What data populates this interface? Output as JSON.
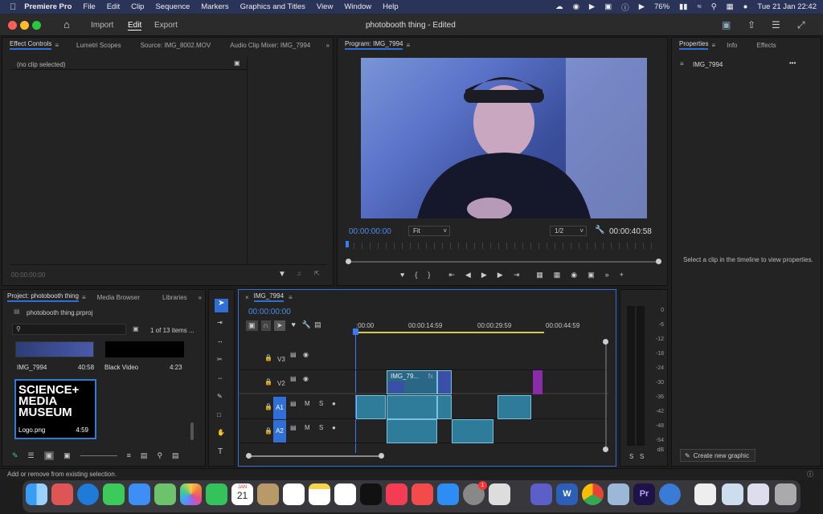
{
  "menubar": {
    "app_name": "Premiere Pro",
    "items": [
      "File",
      "Edit",
      "Clip",
      "Sequence",
      "Markers",
      "Graphics and Titles",
      "View",
      "Window",
      "Help"
    ],
    "battery": "76%",
    "datetime": "Tue 21 Jan  22:42"
  },
  "titlebar": {
    "tabs": [
      "Import",
      "Edit",
      "Export"
    ],
    "active_tab": "Edit",
    "document_title": "photobooth thing - Edited"
  },
  "effect_controls": {
    "tabs": [
      "Effect Controls",
      "Lumetri Scopes",
      "Source: IMG_8002.MOV",
      "Audio Clip Mixer: IMG_7994"
    ],
    "empty_message": "(no clip selected)",
    "timecode": "00:00:00:00"
  },
  "program": {
    "tab": "Program: IMG_7994",
    "timecode_current": "00:00:00:00",
    "fit": "Fit",
    "resolution": "1/2",
    "timecode_duration": "00:00:40:58"
  },
  "properties": {
    "tabs": [
      "Properties",
      "Info",
      "Effects"
    ],
    "clip_name": "IMG_7994",
    "message": "Select a clip in the timeline to view properties.",
    "create_graphic": "Create new graphic"
  },
  "project": {
    "tabs": [
      "Project: photobooth thing",
      "Media Browser",
      "Libraries"
    ],
    "file": "photobooth thing.prproj",
    "count": "1 of 13 items ...",
    "items": [
      {
        "name": "IMG_7994",
        "duration": "40:58"
      },
      {
        "name": "Black Video",
        "duration": "4:23"
      },
      {
        "name": "Logo.png",
        "duration": "4:59"
      }
    ],
    "logo_text": [
      "SCIENCE+",
      "MEDIA",
      "MUSEUM"
    ]
  },
  "timeline": {
    "sequence_tab": "IMG_7994",
    "timecode": "00:00:00:00",
    "ruler": [
      ":00:00",
      "00:00:14:59",
      "00:00:29:59",
      "00:00:44:59"
    ],
    "tracks": [
      "V3",
      "V2",
      "A1",
      "A2"
    ],
    "clip_label": "IMG_79...",
    "mute": "M",
    "solo": "S"
  },
  "meters": {
    "ticks": [
      "0",
      "-6",
      "-12",
      "-18",
      "-24",
      "-30",
      "-36",
      "-42",
      "-48",
      "-54",
      "dB"
    ],
    "solo_labels": [
      "S",
      "S"
    ]
  },
  "status": {
    "message": "Add or remove from existing selection."
  },
  "dock": {
    "calendar_month": "JAN",
    "calendar_day": "21",
    "appstore_badge": "1",
    "premiere_label": "Pr",
    "word_label": "W"
  }
}
